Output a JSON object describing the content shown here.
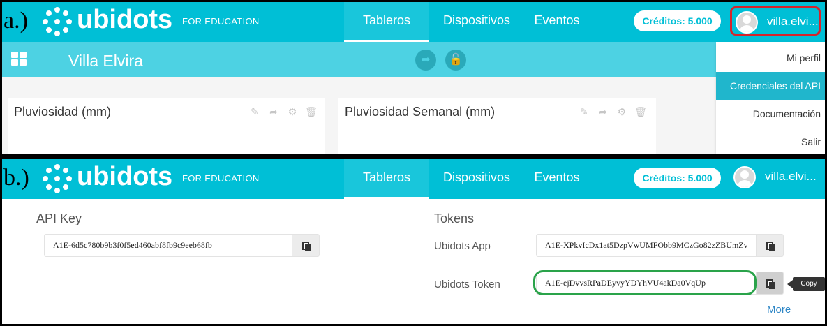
{
  "panel_a": {
    "label": "a.)",
    "brand": {
      "logo_text": "ubidots",
      "tagline": "FOR EDUCATION"
    },
    "nav": {
      "tabs": [
        "Tableros",
        "Dispositivos",
        "Eventos"
      ],
      "active": "Tableros"
    },
    "credits_label": "Créditos: 5.000",
    "username": "villa.elvi...",
    "dashboard_title": "Villa Elvira",
    "widgets": [
      {
        "title": "Pluviosidad (mm)"
      },
      {
        "title": "Pluviosidad Semanal (mm)"
      }
    ],
    "dropdown": {
      "items": [
        "Mi perfil",
        "Credenciales del API",
        "Documentación",
        "Salir"
      ],
      "active": "Credenciales del API"
    },
    "highlight_color": "#d6232a"
  },
  "panel_b": {
    "label": "b.)",
    "brand": {
      "logo_text": "ubidots",
      "tagline": "FOR EDUCATION"
    },
    "nav": {
      "tabs": [
        "Tableros",
        "Dispositivos",
        "Eventos"
      ],
      "active": "Tableros"
    },
    "credits_label": "Créditos: 5.000",
    "username": "villa.elvi...",
    "api_key": {
      "heading": "API Key",
      "value": "A1E-6d5c780b9b3f0f5ed460abf8fb9c9eeb68fb"
    },
    "tokens": {
      "heading": "Tokens",
      "items": [
        {
          "label": "Ubidots App",
          "value": "A1E-XPkvIcDx1at5DzpVwUMFObb9MCzGo82zZBUmZv"
        },
        {
          "label": "Ubidots Token",
          "value": "A1E-ejDvvsRPaDEyvyYDYhVU4akDa0VqUp"
        }
      ],
      "tooltip": "Copy",
      "more_link": "More"
    },
    "highlight_color": "#2aa34a"
  },
  "colors": {
    "brand": "#00bfd6",
    "subbar": "#4dd2e3",
    "active_menu": "#20b6cc",
    "link": "#2f87c6"
  }
}
